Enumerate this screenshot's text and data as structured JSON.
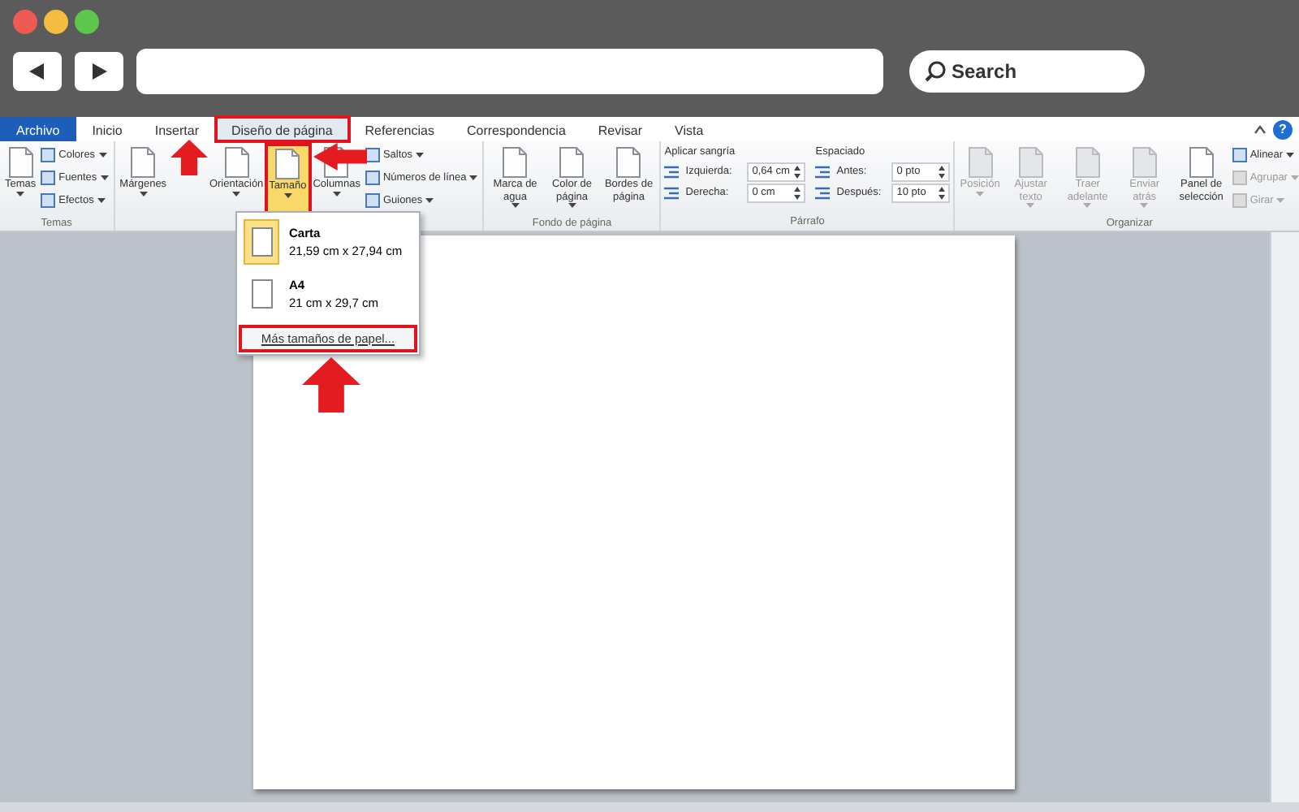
{
  "browser": {
    "search": {
      "placeholder": "Search"
    }
  },
  "tabs": [
    {
      "label": "Archivo",
      "kind": "file",
      "selected": false,
      "highlighted": false
    },
    {
      "label": "Inicio",
      "kind": "tab",
      "selected": false,
      "highlighted": false
    },
    {
      "label": "Insertar",
      "kind": "tab",
      "selected": false,
      "highlighted": false
    },
    {
      "label": "Diseño de página",
      "kind": "tab",
      "selected": true,
      "highlighted": true
    },
    {
      "label": "Referencias",
      "kind": "tab",
      "selected": false,
      "highlighted": false
    },
    {
      "label": "Correspondencia",
      "kind": "tab",
      "selected": false,
      "highlighted": false
    },
    {
      "label": "Revisar",
      "kind": "tab",
      "selected": false,
      "highlighted": false
    },
    {
      "label": "Vista",
      "kind": "tab",
      "selected": false,
      "highlighted": false
    }
  ],
  "help": "?",
  "groups": [
    {
      "label": "Temas",
      "items": [
        {
          "kind": "large",
          "label": "Temas",
          "dropdown": true,
          "disabled": false,
          "selected": false,
          "highlighted": false
        },
        {
          "kind": "small",
          "label": "Colores",
          "dropdown": true,
          "disabled": false
        },
        {
          "kind": "small",
          "label": "Fuentes",
          "dropdown": true,
          "disabled": false
        },
        {
          "kind": "small",
          "label": "Efectos",
          "dropdown": true,
          "disabled": false
        }
      ]
    },
    {
      "items": [
        {
          "kind": "large",
          "label": "Márgenes",
          "dropdown": true,
          "disabled": false,
          "selected": false,
          "highlighted": false
        },
        {
          "kind": "large",
          "label": "Orientación",
          "dropdown": true,
          "disabled": false,
          "selected": false,
          "highlighted": false
        },
        {
          "kind": "large",
          "label": "Tamaño",
          "dropdown": true,
          "disabled": false,
          "selected": true,
          "highlighted": true
        },
        {
          "kind": "large",
          "label": "Columnas",
          "dropdown": true,
          "disabled": false,
          "selected": false,
          "highlighted": false
        },
        {
          "kind": "small",
          "label": "Saltos",
          "dropdown": true,
          "disabled": false
        },
        {
          "kind": "small",
          "label": "Números de línea",
          "dropdown": true,
          "disabled": false
        },
        {
          "kind": "small",
          "label": "Guiones",
          "dropdown": true,
          "disabled": false
        }
      ]
    },
    {
      "label": "Fondo de página",
      "items": [
        {
          "kind": "large",
          "label": "Marca de agua",
          "dropdown": true,
          "disabled": false,
          "selected": false,
          "highlighted": false
        },
        {
          "kind": "large",
          "label": "Color de página",
          "dropdown": true,
          "disabled": false,
          "selected": false,
          "highlighted": false
        },
        {
          "kind": "large",
          "label": "Bordes de página",
          "dropdown": false,
          "disabled": false,
          "selected": false,
          "highlighted": false
        }
      ]
    },
    {
      "label": "Párrafo",
      "sections": [
        {
          "heading": "Aplicar sangría",
          "fields": [
            {
              "label": "Izquierda:",
              "value": "0,64 cm"
            },
            {
              "label": "Derecha:",
              "value": "0 cm"
            }
          ]
        },
        {
          "heading": "Espaciado",
          "fields": [
            {
              "label": "Antes:",
              "value": "0 pto"
            },
            {
              "label": "Después:",
              "value": "10 pto"
            }
          ]
        }
      ]
    },
    {
      "label": "Organizar",
      "items": [
        {
          "kind": "large",
          "label": "Posición",
          "dropdown": true,
          "disabled": true,
          "selected": false,
          "highlighted": false
        },
        {
          "kind": "large",
          "label": "Ajustar texto",
          "dropdown": true,
          "disabled": true,
          "selected": false,
          "highlighted": false
        },
        {
          "kind": "large",
          "label": "Traer adelante",
          "dropdown": true,
          "disabled": true,
          "selected": false,
          "highlighted": false
        },
        {
          "kind": "large",
          "label": "Enviar atrás",
          "dropdown": true,
          "disabled": true,
          "selected": false,
          "highlighted": false
        },
        {
          "kind": "large",
          "label": "Panel de selección",
          "dropdown": false,
          "disabled": false,
          "selected": false,
          "highlighted": false
        },
        {
          "kind": "small",
          "label": "Alinear",
          "dropdown": true,
          "disabled": false
        },
        {
          "kind": "small",
          "label": "Agrupar",
          "dropdown": true,
          "disabled": true
        },
        {
          "kind": "small",
          "label": "Girar",
          "dropdown": true,
          "disabled": true
        }
      ]
    }
  ],
  "menu": {
    "items": [
      {
        "title": "Carta",
        "detail": "21,59 cm x 27,94 cm",
        "selected": true
      },
      {
        "title": "A4",
        "detail": "21 cm x 29,7 cm",
        "selected": false
      }
    ],
    "footer": {
      "label": "Más tamaños de papel...",
      "highlighted": true
    }
  }
}
